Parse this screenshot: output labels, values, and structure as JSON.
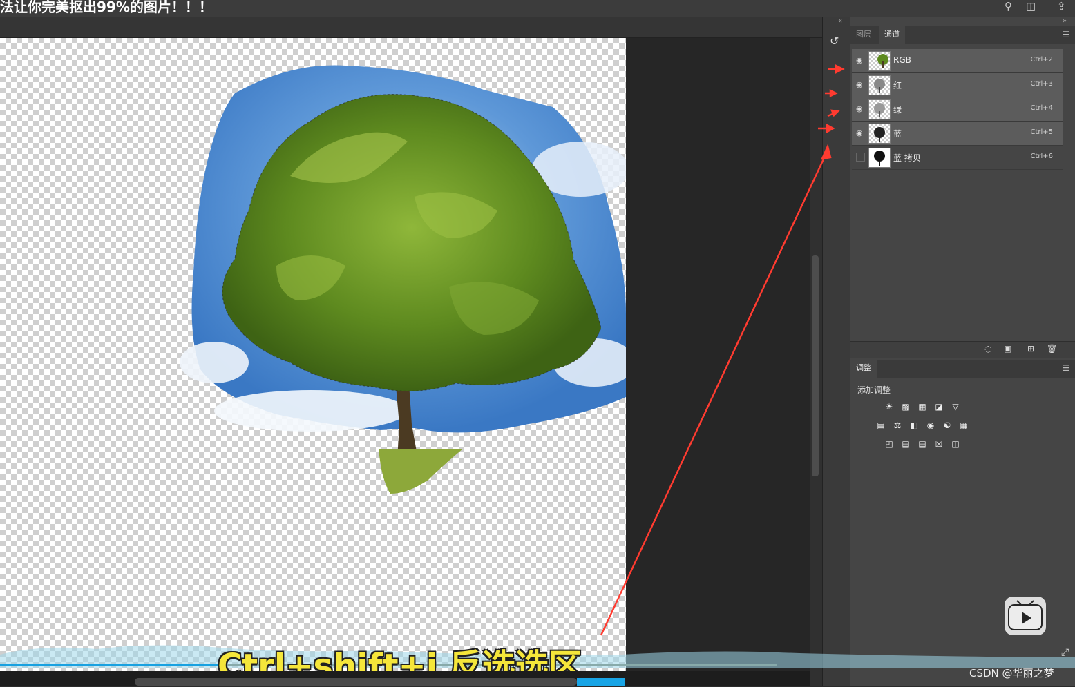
{
  "video": {
    "title": "法让你完美抠出99%的图片！！！",
    "subtitle": "Ctrl+shift+i 反选选区",
    "watermark": "CSDN @华丽之梦"
  },
  "panel": {
    "tabs": [
      {
        "label": "图层",
        "active": false
      },
      {
        "label": "通道",
        "active": true
      }
    ],
    "channels": [
      {
        "name": "RGB",
        "shortcut": "Ctrl+2",
        "visible": true,
        "selected": true
      },
      {
        "name": "红",
        "shortcut": "Ctrl+3",
        "visible": true,
        "selected": true
      },
      {
        "name": "绿",
        "shortcut": "Ctrl+4",
        "visible": true,
        "selected": true
      },
      {
        "name": "蓝",
        "shortcut": "Ctrl+5",
        "visible": true,
        "selected": true
      },
      {
        "name": "蓝 拷贝",
        "shortcut": "Ctrl+6",
        "visible": false,
        "selected": false
      }
    ],
    "adjustments": {
      "tab_label": "调整",
      "add_label": "添加调整"
    }
  },
  "colors": {
    "annotation_arrow": "#ff3b30",
    "subtitle": "#f5e63a",
    "progress": "#18a1e0"
  }
}
